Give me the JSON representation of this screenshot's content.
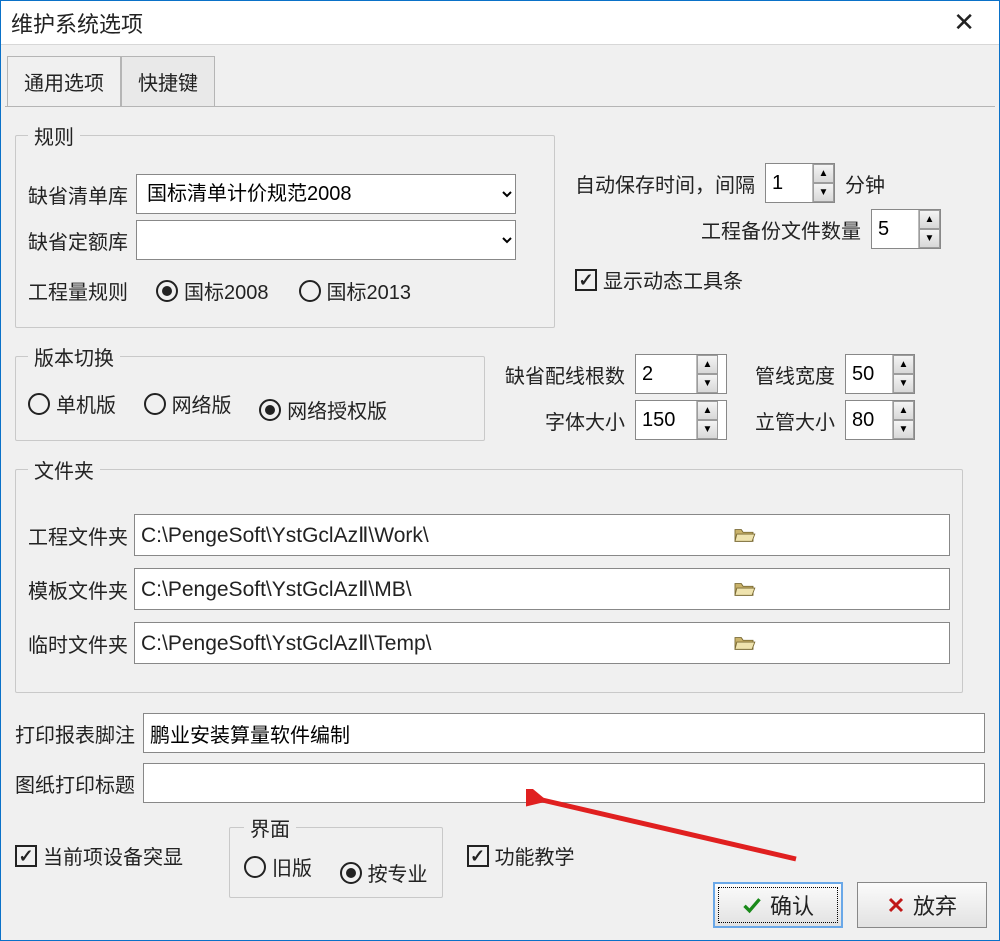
{
  "window": {
    "title": "维护系统选项"
  },
  "tabs": {
    "general": "通用选项",
    "shortcut": "快捷键"
  },
  "rules": {
    "legend": "规则",
    "list_lib_label": "缺省清单库",
    "list_lib_value": "国标清单计价规范2008",
    "quota_lib_label": "缺省定额库",
    "quota_lib_value": "",
    "qty_rule_label": "工程量规则",
    "qty_rule_opt1": "国标2008",
    "qty_rule_opt2": "国标2013"
  },
  "version": {
    "legend": "版本切换",
    "opt1": "单机版",
    "opt2": "网络版",
    "opt3": "网络授权版"
  },
  "autosave": {
    "label": "自动保存时间，间隔",
    "value": "1",
    "unit": "分钟",
    "backup_label": "工程备份文件数量",
    "backup_value": "5"
  },
  "toolbar": {
    "show_dynamic": "显示动态工具条"
  },
  "params": {
    "wire_count_label": "缺省配线根数",
    "wire_count_value": "2",
    "pipe_width_label": "管线宽度",
    "pipe_width_value": "50",
    "font_size_label": "字体大小",
    "font_size_value": "150",
    "riser_size_label": "立管大小",
    "riser_size_value": "80"
  },
  "folders": {
    "legend": "文件夹",
    "work_label": "工程文件夹",
    "work_value": "C:\\PengeSoft\\YstGclAzⅡ\\Work\\",
    "mb_label": "模板文件夹",
    "mb_value": "C:\\PengeSoft\\YstGclAzⅡ\\MB\\",
    "temp_label": "临时文件夹",
    "temp_value": "C:\\PengeSoft\\YstGclAzⅡ\\Temp\\"
  },
  "footer": {
    "print_foot_label": "打印报表脚注",
    "print_foot_value": "鹏业安装算量软件编制",
    "sheet_title_label": "图纸打印标题",
    "sheet_title_value": ""
  },
  "bottom": {
    "highlight": "当前项设备突显",
    "ui_legend": "界面",
    "ui_opt1": "旧版",
    "ui_opt2": "按专业",
    "tutorial": "功能教学"
  },
  "buttons": {
    "ok": "确认",
    "cancel": "放弃"
  }
}
